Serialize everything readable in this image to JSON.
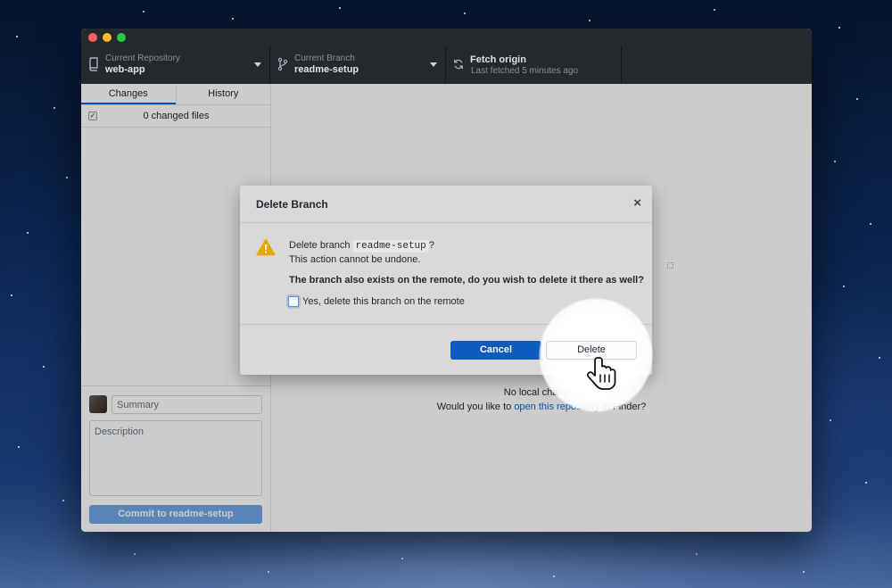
{
  "toolbar": {
    "repo_caption": "Current Repository",
    "repo_name": "web-app",
    "branch_caption": "Current Branch",
    "branch_name": "readme-setup",
    "fetch_title": "Fetch origin",
    "fetch_sub": "Last fetched 5 minutes ago"
  },
  "sidebar": {
    "tabs": [
      {
        "label": "Changes",
        "active": true
      },
      {
        "label": "History",
        "active": false
      }
    ],
    "changed_files": "0 changed files",
    "commit": {
      "summary_placeholder": "Summary",
      "description_placeholder": "Description",
      "button_label": "Commit to readme-setup"
    }
  },
  "main": {
    "no_changes": "No local changes",
    "open_prefix": "Would you like to ",
    "open_link": "open this repository",
    "open_suffix": " in Finder?"
  },
  "dialog": {
    "title": "Delete Branch",
    "close_glyph": "×",
    "message_prefix": "Delete branch ",
    "branch": "readme-setup",
    "message_suffix": "?",
    "warning": "This action cannot be undone.",
    "remote_question": "The branch also exists on the remote, do you wish to delete it there as well?",
    "checkbox_label": "Yes, delete this branch on the remote",
    "checkbox_checked": false,
    "cancel_label": "Cancel",
    "delete_label": "Delete"
  },
  "icons": {
    "repo": "repo-icon",
    "branch": "git-branch-icon",
    "fetch": "sync-icon",
    "warning": "warning-icon",
    "cursor": "hand-pointer-icon"
  },
  "colors": {
    "toolbar_bg": "#24292e",
    "accent_blue": "#0366d6",
    "cancel_blue": "#0e5bbd",
    "warning_yellow": "#e5a800"
  }
}
